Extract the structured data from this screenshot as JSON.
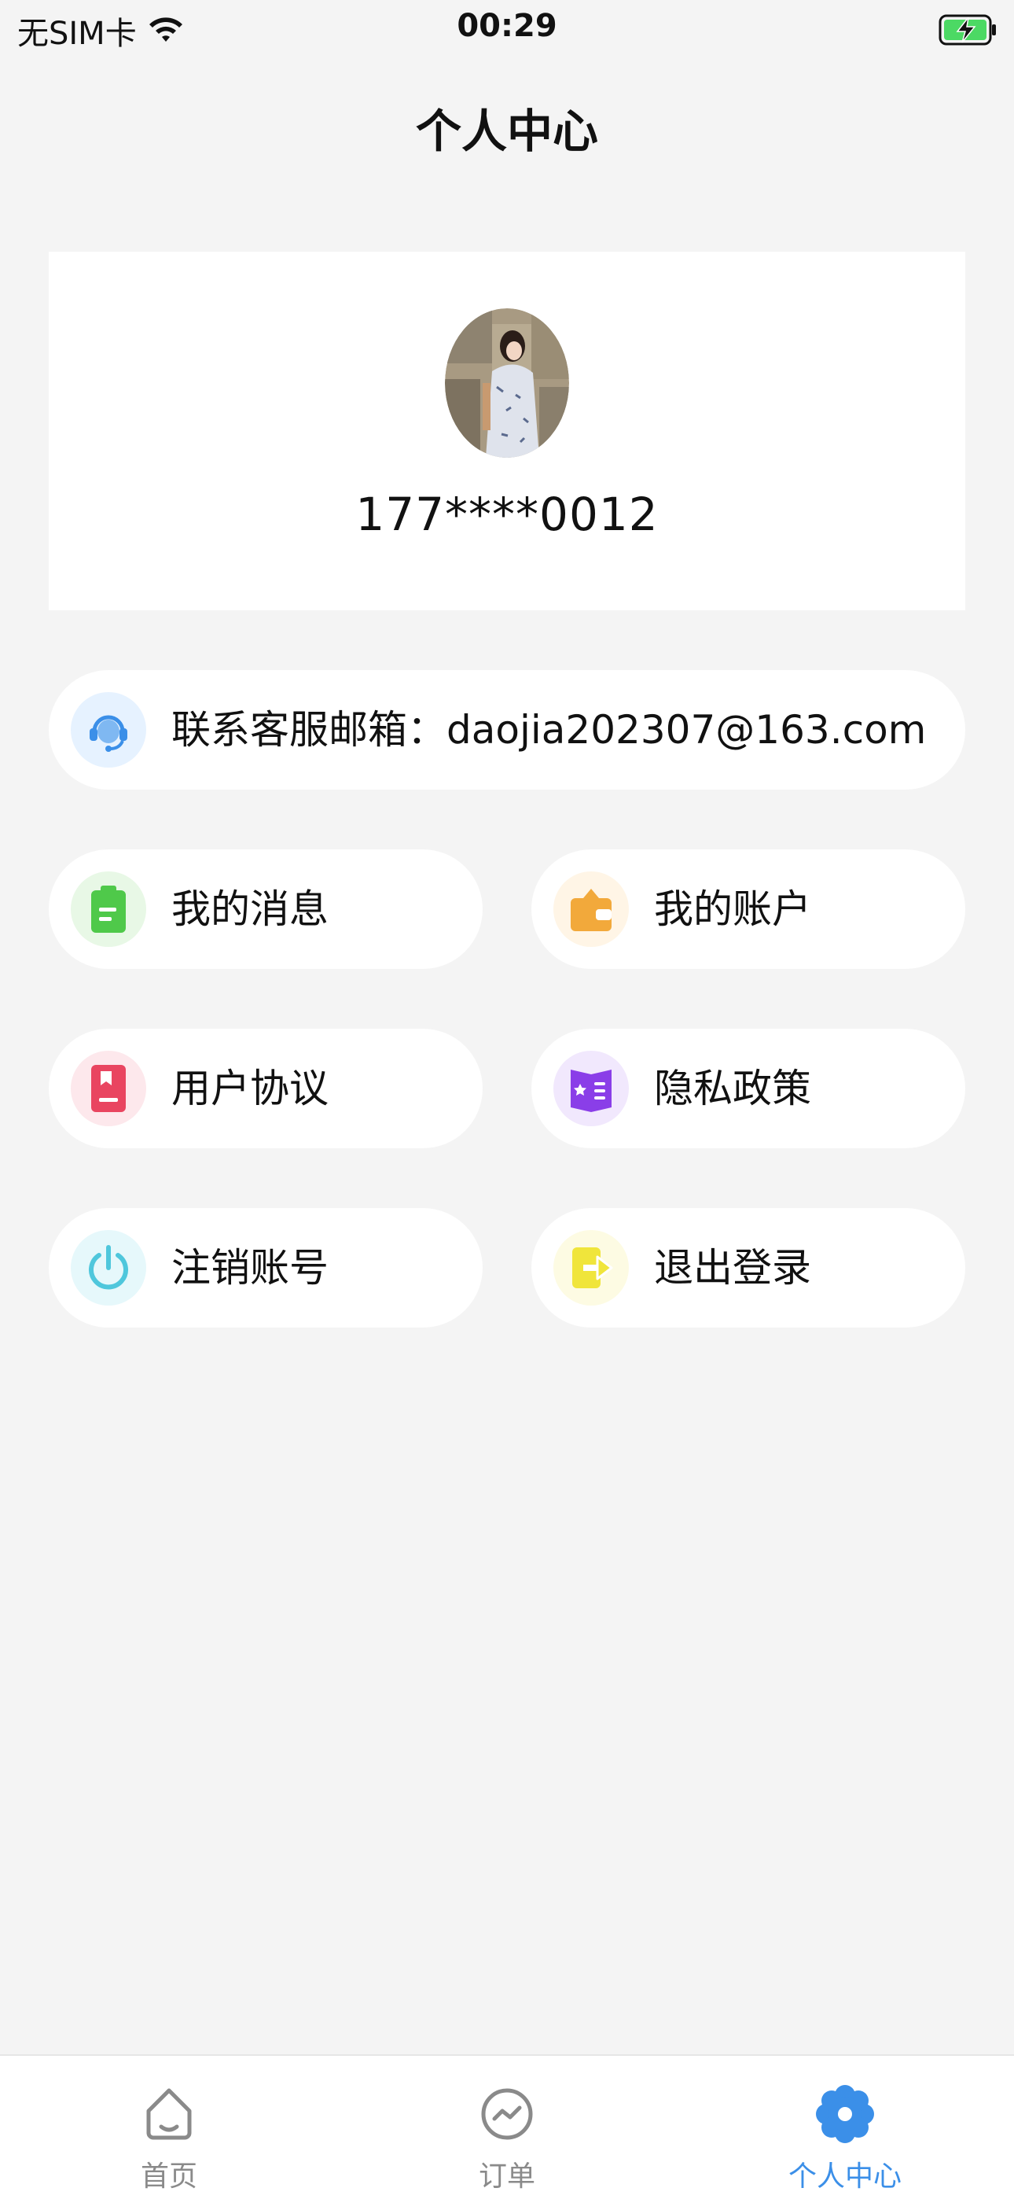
{
  "status_bar": {
    "carrier": "无SIM卡",
    "time": "00:29",
    "icons": [
      "wifi-icon",
      "battery-charging-icon"
    ]
  },
  "header": {
    "title": "个人中心"
  },
  "profile": {
    "phone": "177****0012",
    "avatar": "avatar-photo"
  },
  "service": {
    "label": "联系客服邮箱：daojia202307@163.com",
    "icon": "headset-icon",
    "icon_bg": "#e6f2ff",
    "icon_color": "#3b8fe8"
  },
  "menu": [
    {
      "label": "我的消息",
      "icon": "clipboard-icon",
      "icon_bg": "#e8f8e6",
      "icon_color": "#4fc94a"
    },
    {
      "label": "我的账户",
      "icon": "wallet-icon",
      "icon_bg": "#fff5e6",
      "icon_color": "#f2a93b"
    },
    {
      "label": "用户协议",
      "icon": "document-icon",
      "icon_bg": "#fde8ec",
      "icon_color": "#e94560"
    },
    {
      "label": "隐私政策",
      "icon": "privacy-book-icon",
      "icon_bg": "#f1e8fd",
      "icon_color": "#8a3ee8"
    },
    {
      "label": "注销账号",
      "icon": "power-icon",
      "icon_bg": "#e6f8fb",
      "icon_color": "#4fc7dc"
    },
    {
      "label": "退出登录",
      "icon": "logout-icon",
      "icon_bg": "#fdfbe3",
      "icon_color": "#f0e53b"
    }
  ],
  "tab_bar": {
    "tabs": [
      {
        "label": "首页",
        "icon": "home-icon",
        "active": false
      },
      {
        "label": "订单",
        "icon": "orders-icon",
        "active": false
      },
      {
        "label": "个人中心",
        "icon": "gear-flower-icon",
        "active": true
      }
    ],
    "active_color": "#3b8fe8",
    "inactive_color": "#8a8a8a"
  }
}
